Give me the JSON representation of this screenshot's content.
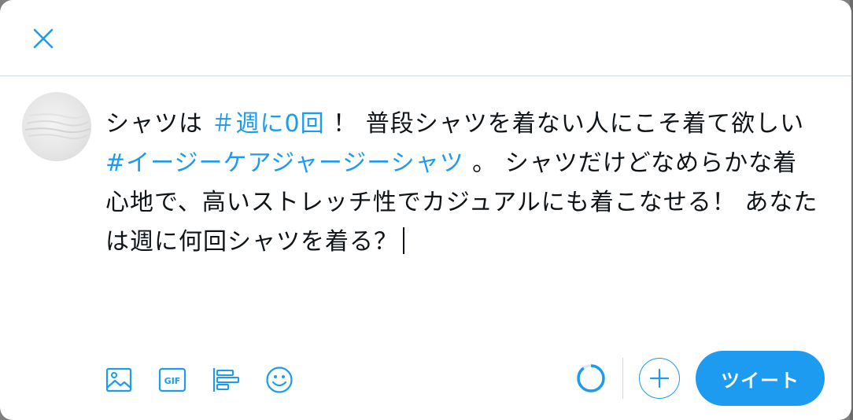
{
  "compose": {
    "segments": [
      {
        "text": "シャツは ",
        "type": "text"
      },
      {
        "text": "＃週に0回",
        "type": "hashtag"
      },
      {
        "text": " ！ 普段シャツを着ない人にこそ着て欲しい ",
        "type": "text"
      },
      {
        "text": "#イージーケアジャージーシャツ",
        "type": "hashtag"
      },
      {
        "text": " 。 シャツだけどなめらかな着心地で、高いストレッチ性でカジュアルにも着こなせる！ あなたは週に何回シャツを着る？",
        "type": "text"
      }
    ]
  },
  "toolbar": {
    "icons": [
      "image-icon",
      "gif-icon",
      "poll-icon",
      "emoji-icon"
    ],
    "gif_label": "GIF"
  },
  "actions": {
    "tweet_label": "ツイート",
    "char_progress": 0.9
  },
  "colors": {
    "accent": "#1d9bf0",
    "text": "#0f1419",
    "divider": "#cfd9de"
  }
}
